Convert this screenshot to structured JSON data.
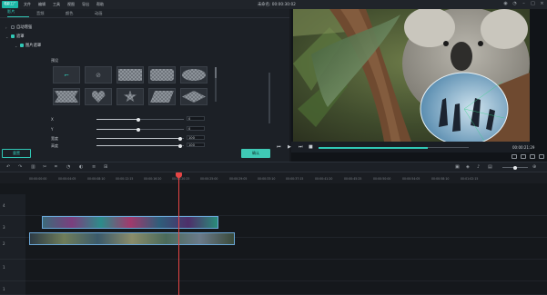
{
  "app": {
    "logo_text": "喵影工厂",
    "title": "未命名: 00:00:30:02"
  },
  "menu": [
    "文件",
    "编辑",
    "工具",
    "视图",
    "导出",
    "帮助"
  ],
  "tabs": [
    "影片",
    "音频",
    "颜色",
    "动画"
  ],
  "panel": {
    "auto_enhance": "自动增强",
    "mask": "遮罩",
    "image_mask": "图片遮罩",
    "preset_label": "预设",
    "params": [
      {
        "label": "X",
        "value": "0",
        "fill": 0.48
      },
      {
        "label": "Y",
        "value": "0",
        "fill": 0.48
      },
      {
        "label": "宽度",
        "value": "100",
        "fill": 0.95
      },
      {
        "label": "高度",
        "value": "100",
        "fill": 0.95
      }
    ],
    "reset_label": "重置",
    "ok_label": "确认"
  },
  "preview": {
    "timecode": "00:00:21:29",
    "progress": 0.73
  },
  "ruler": [
    "00:00:00:00",
    "00:00:04:05",
    "00:00:08:10",
    "00:00:12:15",
    "00:00:16:20",
    "00:00:20:25",
    "00:00:25:00",
    "00:00:29:05",
    "00:00:33:10",
    "00:00:37:15",
    "00:00:41:20",
    "00:00:45:25",
    "00:00:50:00",
    "00:00:54:05",
    "00:00:58:10",
    "00:01:02:15"
  ],
  "tracks": [
    "4",
    "3",
    "2",
    "1",
    "1"
  ],
  "colors": {
    "accent": "#30c7b5",
    "playhead": "#e64545"
  }
}
